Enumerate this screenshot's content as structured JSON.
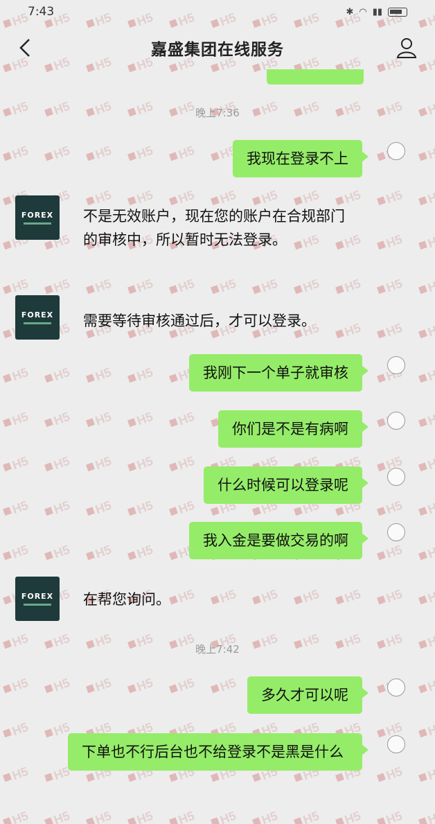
{
  "status_bar": {
    "time": "7:43"
  },
  "nav": {
    "title": "嘉盛集团在线服务"
  },
  "agent_avatar": {
    "brand": "FOREX"
  },
  "timestamps": [
    "晚上7:36",
    "晚上7:42"
  ],
  "messages": [
    {
      "side": "right",
      "text": "我现在登录不上"
    },
    {
      "side": "left",
      "text": "不是无效账户，现在您的账户在合规部门的审核中，所以暂时无法登录。"
    },
    {
      "side": "left",
      "text": "需要等待审核通过后，才可以登录。"
    },
    {
      "side": "right",
      "text": "我刚下一个单子就审核"
    },
    {
      "side": "right",
      "text": "你们是不是有病啊"
    },
    {
      "side": "right",
      "text": "什么时候可以登录呢"
    },
    {
      "side": "right",
      "text": "我入金是要做交易的啊"
    },
    {
      "side": "left",
      "text": "在帮您询问。"
    },
    {
      "side": "right",
      "text": "多久才可以呢"
    },
    {
      "side": "right",
      "text": "下单也不行后台也不给登录不是黑是什么"
    }
  ],
  "colors": {
    "bubble_right": "#95ec69",
    "background": "#ededed"
  }
}
